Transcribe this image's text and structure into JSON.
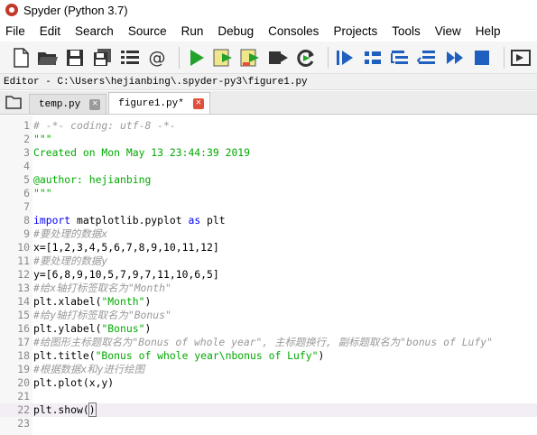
{
  "window": {
    "title": "Spyder (Python 3.7)"
  },
  "menu": [
    "File",
    "Edit",
    "Search",
    "Source",
    "Run",
    "Debug",
    "Consoles",
    "Projects",
    "Tools",
    "View",
    "Help"
  ],
  "toolbar": {
    "buttons": [
      "new-file-icon",
      "open-folder-icon",
      "save-icon",
      "save-all-icon",
      "list-icon",
      "at-icon",
      "run-icon",
      "run-cell-icon",
      "run-cell-advance-icon",
      "run-selection-icon",
      "rerun-icon",
      "debug-icon",
      "step-icon",
      "step-into-icon",
      "step-return-icon",
      "continue-icon",
      "stop-icon",
      "maximize-icon"
    ]
  },
  "path": {
    "text": "Editor - C:\\Users\\hejianbing\\.spyder-py3\\figure1.py"
  },
  "tabs": [
    {
      "label": "temp.py",
      "active": false
    },
    {
      "label": "figure1.py*",
      "active": true
    }
  ],
  "editor": {
    "lines": [
      {
        "n": "1",
        "parts": [
          {
            "t": "# -*- coding: utf-8 -*-",
            "c": "comment"
          }
        ]
      },
      {
        "n": "2",
        "parts": [
          {
            "t": "\"\"\"",
            "c": "string"
          }
        ]
      },
      {
        "n": "3",
        "parts": [
          {
            "t": "Created on Mon May 13 23:44:39 2019",
            "c": "string"
          }
        ]
      },
      {
        "n": "4",
        "parts": []
      },
      {
        "n": "5",
        "parts": [
          {
            "t": "@author: hejianbing",
            "c": "string"
          }
        ]
      },
      {
        "n": "6",
        "parts": [
          {
            "t": "\"\"\"",
            "c": "string"
          }
        ]
      },
      {
        "n": "7",
        "parts": []
      },
      {
        "n": "8",
        "parts": [
          {
            "t": "import",
            "c": "keyword"
          },
          {
            "t": " matplotlib.pyplot ",
            "c": "default"
          },
          {
            "t": "as",
            "c": "keyword"
          },
          {
            "t": " plt",
            "c": "default"
          }
        ]
      },
      {
        "n": "9",
        "parts": [
          {
            "t": "#要处理的数据x",
            "c": "comment"
          }
        ]
      },
      {
        "n": "10",
        "parts": [
          {
            "t": "x=[1,2,3,4,5,6,7,8,9,10,11,12]",
            "c": "default"
          }
        ]
      },
      {
        "n": "11",
        "parts": [
          {
            "t": "#要处理的数据y",
            "c": "comment"
          }
        ]
      },
      {
        "n": "12",
        "parts": [
          {
            "t": "y=[6,8,9,10,5,7,9,7,11,10,6,5]",
            "c": "default"
          }
        ]
      },
      {
        "n": "13",
        "parts": [
          {
            "t": "#给x轴打标签取名为\"Month\"",
            "c": "comment"
          }
        ]
      },
      {
        "n": "14",
        "parts": [
          {
            "t": "plt.xlabel(",
            "c": "default"
          },
          {
            "t": "\"Month\"",
            "c": "string"
          },
          {
            "t": ")",
            "c": "default"
          }
        ]
      },
      {
        "n": "15",
        "parts": [
          {
            "t": "#给y轴打标签取名为\"Bonus\"",
            "c": "comment"
          }
        ]
      },
      {
        "n": "16",
        "parts": [
          {
            "t": "plt.ylabel(",
            "c": "default"
          },
          {
            "t": "\"Bonus\"",
            "c": "string"
          },
          {
            "t": ")",
            "c": "default"
          }
        ]
      },
      {
        "n": "17",
        "parts": [
          {
            "t": "#给图形主标题取名为\"Bonus of whole year\", 主标题换行, 副标题取名为\"bonus of Lufy\"",
            "c": "comment"
          }
        ]
      },
      {
        "n": "18",
        "parts": [
          {
            "t": "plt.title(",
            "c": "default"
          },
          {
            "t": "\"Bonus of whole year\\nbonus of Lufy\"",
            "c": "string"
          },
          {
            "t": ")",
            "c": "default"
          }
        ]
      },
      {
        "n": "19",
        "parts": [
          {
            "t": "#根据数据x和y进行绘图",
            "c": "comment"
          }
        ]
      },
      {
        "n": "20",
        "parts": [
          {
            "t": "plt.plot(x,y)",
            "c": "default"
          }
        ]
      },
      {
        "n": "21",
        "parts": []
      },
      {
        "n": "22",
        "parts": [
          {
            "t": "plt.show(",
            "c": "default"
          },
          {
            "t": ")",
            "c": "cursor"
          }
        ],
        "current": true
      },
      {
        "n": "23",
        "parts": []
      }
    ]
  },
  "colors": {
    "comment": "#999999",
    "string": "#00aa00",
    "keyword": "#0000ff",
    "run_green": "#22a22a",
    "debug_blue": "#1f5fbf"
  }
}
